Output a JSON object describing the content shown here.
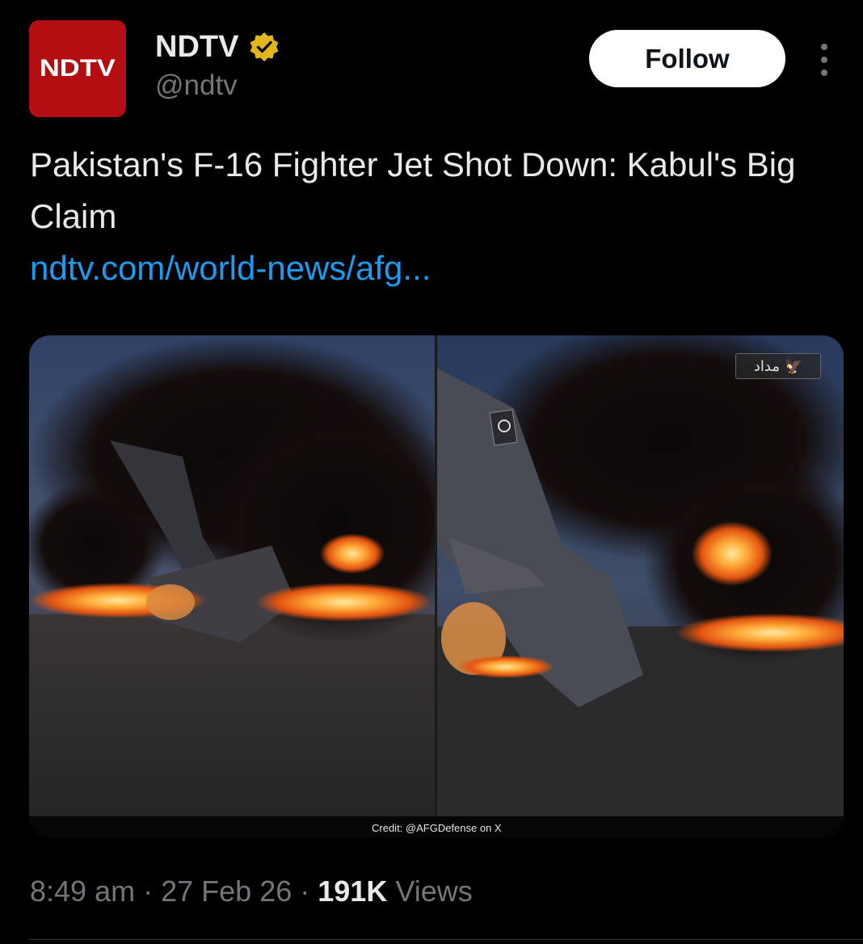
{
  "author": {
    "avatar_text": "NDTV",
    "display_name": "NDTV",
    "handle": "@ndtv",
    "verified": true,
    "avatar_color": "#b30f12",
    "badge_color": "#e2b719"
  },
  "actions": {
    "follow_label": "Follow",
    "more_icon": "more-vertical-icon"
  },
  "tweet": {
    "text": "Pakistan's F-16 Fighter Jet Shot Down: Kabul's Big Claim",
    "link_text": "ndtv.com/world-news/afg..."
  },
  "media": {
    "credit": "Credit: @AFGDefense on X",
    "watermark": "مداد 🦅"
  },
  "meta": {
    "time": "8:49 am",
    "separator": "·",
    "date": "27 Feb 26",
    "views_count": "191K",
    "views_label": "Views"
  },
  "colors": {
    "background": "#000000",
    "text_primary": "#e7e9ea",
    "text_secondary": "#71767b",
    "link": "#1d9bf0",
    "follow_bg": "#ffffff"
  }
}
